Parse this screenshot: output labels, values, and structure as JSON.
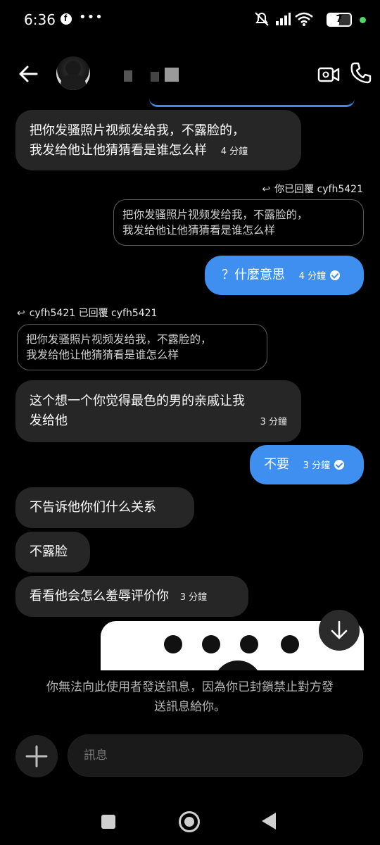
{
  "status_bar": {
    "time": "6:36",
    "battery": "7",
    "overflow_dots": "•••"
  },
  "header": {
    "contact_name_hidden": true,
    "icons": [
      "back-arrow-icon",
      "video-call-icon",
      "phone-icon"
    ]
  },
  "messages": [
    {
      "dir": "in",
      "text_line1": "把你发骚照片视频发给我，不露脸的，",
      "text_line2": "我发给他让他猜猜看是谁怎么样",
      "time": "4 分鐘"
    },
    {
      "reply_label": "你已回覆 cyfh5421",
      "quote_line1": "把你发骚照片视频发给我，不露脸的，",
      "quote_line2": "我发给他让他猜猜看是谁怎么样"
    },
    {
      "dir": "out",
      "text": "？什麼意思",
      "time": "4 分鐘"
    },
    {
      "reply_label": "cyfh5421 已回覆 cyfh5421",
      "quote_line1": "把你发骚照片视频发给我，不露脸的，",
      "quote_line2": "我发给他让他猜猜看是谁怎么样"
    },
    {
      "dir": "in",
      "text_line1": "这个想一个你觉得最色的男的亲戚让我",
      "text_line2": "发给他",
      "time": "3 分鐘"
    },
    {
      "dir": "out",
      "text": "不要",
      "time": "3 分鐘"
    },
    {
      "dir": "in",
      "text": "不告诉他你们什么关系"
    },
    {
      "dir": "in",
      "text": "不露脸"
    },
    {
      "dir": "in",
      "text": "看看他会怎么羞辱评价你",
      "time": "3 分鐘"
    }
  ],
  "blocked_notice": {
    "line1": "你無法向此使用者發送訊息，因為你已封鎖禁止對方發",
    "line2": "送訊息給你。"
  },
  "composer": {
    "placeholder": "訊息"
  },
  "colors": {
    "background": "#000000",
    "incoming_bubble": "#262626",
    "outgoing_bubble": "#3e8ff0"
  }
}
